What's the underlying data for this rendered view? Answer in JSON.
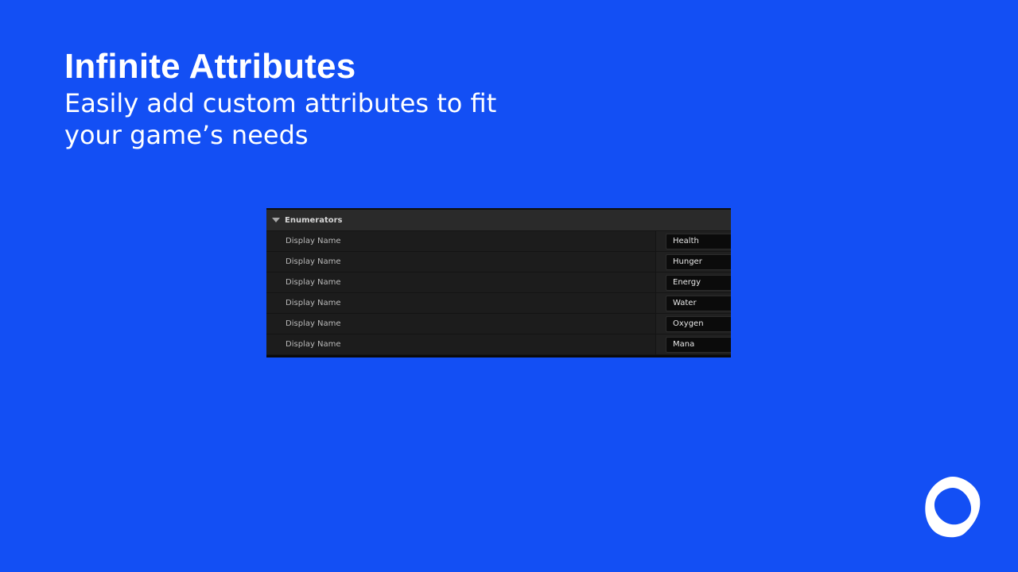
{
  "heading": {
    "title": "Infinite Attributes",
    "subtitle": "Easily add custom attributes to fit your game’s needs"
  },
  "panel": {
    "section_title": "Enumerators",
    "rows": [
      {
        "label": "Display Name",
        "value": "Health"
      },
      {
        "label": "Display Name",
        "value": "Hunger"
      },
      {
        "label": "Display Name",
        "value": "Energy"
      },
      {
        "label": "Display Name",
        "value": "Water"
      },
      {
        "label": "Display Name",
        "value": "Oxygen"
      },
      {
        "label": "Display Name",
        "value": "Mana"
      }
    ]
  },
  "colors": {
    "background": "#134ff4",
    "panel": "#1f1f1f",
    "text": "#ffffff"
  },
  "icons": {
    "collapse": "caret-down-icon",
    "brand": "logo-icon"
  }
}
